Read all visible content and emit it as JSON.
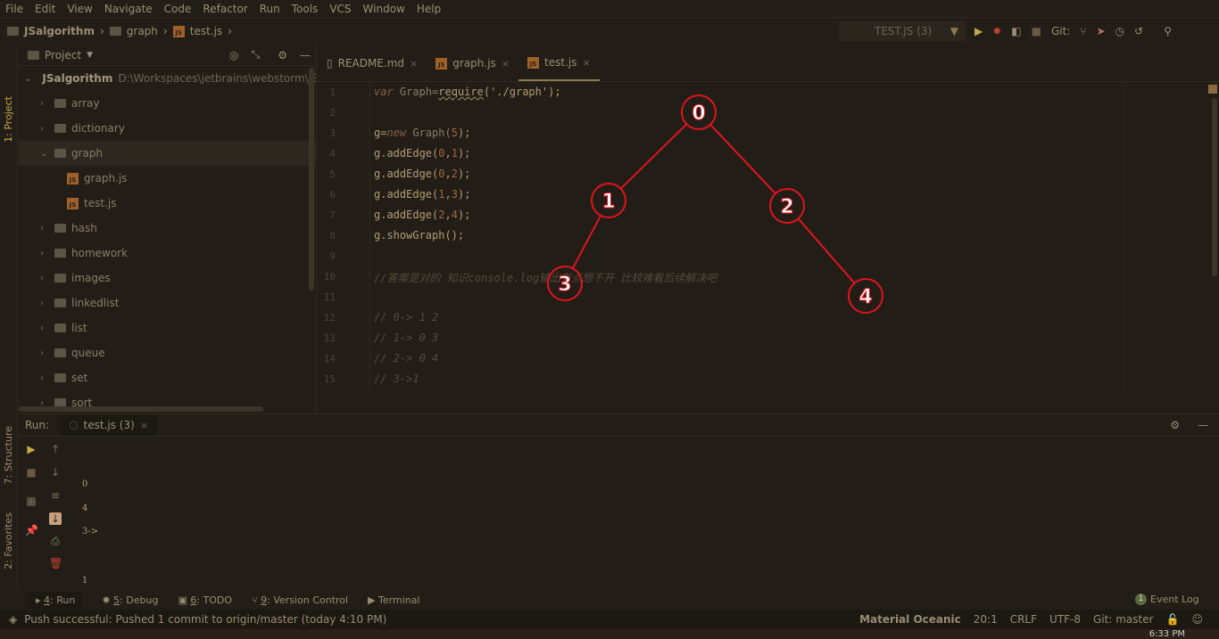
{
  "menu": [
    "File",
    "Edit",
    "View",
    "Navigate",
    "Code",
    "Refactor",
    "Run",
    "Tools",
    "VCS",
    "Window",
    "Help"
  ],
  "breadcrumb": [
    "JSalgorithm",
    "graph",
    "test.js"
  ],
  "run_config": "TEST.JS (3)",
  "git_label": "Git:",
  "left_tools": {
    "project": "1: Project",
    "structure": "7: Structure",
    "favorites": "2: Favorites"
  },
  "project": {
    "title": "Project",
    "root": {
      "name": "JSalgorithm",
      "path": "D:\\Workspaces\\jetbrains\\webstorm\\JSalg"
    },
    "items": [
      {
        "name": "array",
        "type": "folder",
        "depth": 1,
        "open": false
      },
      {
        "name": "dictionary",
        "type": "folder",
        "depth": 1,
        "open": false
      },
      {
        "name": "graph",
        "type": "folder",
        "depth": 1,
        "open": true,
        "selected": true
      },
      {
        "name": "graph.js",
        "type": "js",
        "depth": 2
      },
      {
        "name": "test.js",
        "type": "js",
        "depth": 2
      },
      {
        "name": "hash",
        "type": "folder",
        "depth": 1,
        "open": false
      },
      {
        "name": "homework",
        "type": "folder",
        "depth": 1,
        "open": false
      },
      {
        "name": "images",
        "type": "folder",
        "depth": 1,
        "open": false
      },
      {
        "name": "linkedlist",
        "type": "folder",
        "depth": 1,
        "open": false
      },
      {
        "name": "list",
        "type": "folder",
        "depth": 1,
        "open": false
      },
      {
        "name": "queue",
        "type": "folder",
        "depth": 1,
        "open": false
      },
      {
        "name": "set",
        "type": "folder",
        "depth": 1,
        "open": false
      },
      {
        "name": "sort",
        "type": "folder",
        "depth": 1,
        "open": false
      }
    ]
  },
  "editor_tabs": [
    {
      "label": "README.md",
      "icon": "markdown-icon",
      "active": false
    },
    {
      "label": "graph.js",
      "icon": "js-file-icon",
      "active": false
    },
    {
      "label": "test.js",
      "icon": "js-file-icon",
      "active": true
    }
  ],
  "code": [
    [
      [
        "var",
        "kw"
      ],
      [
        " Graph=",
        "id"
      ],
      [
        "require",
        "fn"
      ],
      [
        "('./graph');",
        "str"
      ]
    ],
    [],
    [
      [
        "g=",
        "str"
      ],
      [
        "new",
        "kw"
      ],
      [
        " Graph(",
        "id"
      ],
      [
        "5",
        "num"
      ],
      [
        ");",
        "str"
      ]
    ],
    [
      [
        "g.addEdge(",
        "str"
      ],
      [
        "0",
        "num"
      ],
      [
        ",",
        "str"
      ],
      [
        "1",
        "num"
      ],
      [
        ");",
        "str"
      ]
    ],
    [
      [
        "g.addEdge(",
        "str"
      ],
      [
        "0",
        "num"
      ],
      [
        ",",
        "str"
      ],
      [
        "2",
        "num"
      ],
      [
        ");",
        "str"
      ]
    ],
    [
      [
        "g.addEdge(",
        "str"
      ],
      [
        "1",
        "num"
      ],
      [
        ",",
        "str"
      ],
      [
        "3",
        "num"
      ],
      [
        ");",
        "str"
      ]
    ],
    [
      [
        "g.addEdge(",
        "str"
      ],
      [
        "2",
        "num"
      ],
      [
        ",",
        "str"
      ],
      [
        "4",
        "num"
      ],
      [
        ");",
        "str"
      ]
    ],
    [
      [
        "g.showGraph();",
        "str"
      ]
    ],
    [],
    [
      [
        "//答案是对的 知识console.log输出有点想不开 比较难看后续解决吧",
        "com"
      ]
    ],
    [],
    [
      [
        "// 0-> 1 2",
        "com"
      ]
    ],
    [
      [
        "// 1-> 0 3",
        "com"
      ]
    ],
    [
      [
        "// 2-> 0 4",
        "com"
      ]
    ],
    [
      [
        "// 3->1",
        "com"
      ]
    ]
  ],
  "annotation": {
    "color": "#e0141e",
    "nodes": [
      "0",
      "1",
      "2",
      "3",
      "4"
    ],
    "edges": [
      [
        "0",
        "1"
      ],
      [
        "0",
        "2"
      ],
      [
        "1",
        "3"
      ],
      [
        "2",
        "4"
      ]
    ]
  },
  "run": {
    "label": "Run:",
    "tab": "test.js (3)",
    "output": [
      "0",
      "4",
      "3->",
      "1"
    ]
  },
  "bottom_tabs": [
    {
      "key": "4",
      "label": ": Run",
      "icon": "run-icon"
    },
    {
      "key": "5",
      "label": ": Debug",
      "icon": "debug-icon"
    },
    {
      "key": "6",
      "label": ": TODO",
      "icon": "todo-icon"
    },
    {
      "key": "9",
      "label": ": Version Control",
      "icon": "vcs-icon"
    },
    {
      "key": "",
      "label": "Terminal",
      "icon": "terminal-icon"
    }
  ],
  "event_log": {
    "count": "1",
    "label": "Event Log"
  },
  "status": {
    "message": "Push successful: Pushed 1 commit to origin/master (today 4:10 PM)",
    "theme": "Material Oceanic",
    "position": "20:1",
    "line_sep": "CRLF",
    "encoding": "UTF-8",
    "branch": "Git: master"
  },
  "clock": "6:33 PM",
  "colors": {
    "background": "#221e17",
    "accent": "#8a7a52",
    "annotation": "#e0141e"
  }
}
